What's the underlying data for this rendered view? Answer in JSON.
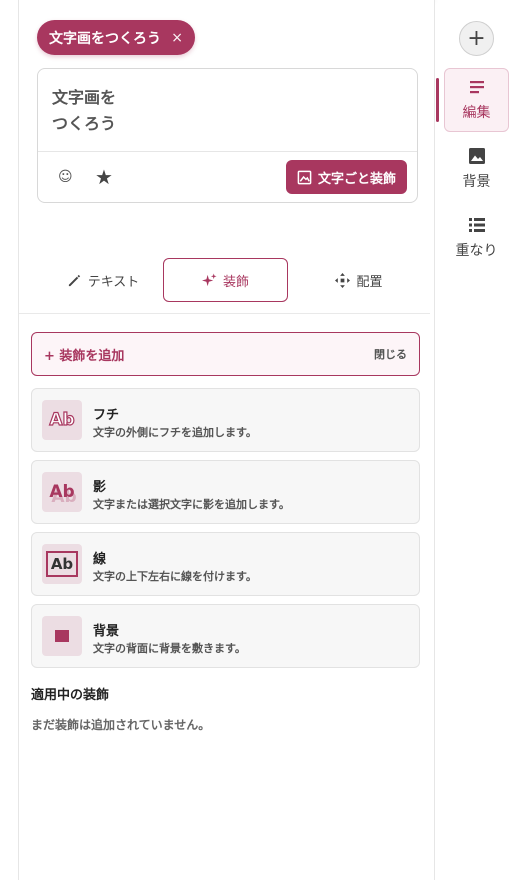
{
  "chip": {
    "label": "文字画をつくろう",
    "close": "×"
  },
  "editor": {
    "line1": "文字画を",
    "line2": "つくろう",
    "emoji_icon": "☺",
    "star_icon": "★",
    "decorate_button": "文字ごと装飾"
  },
  "tabs": [
    {
      "label": "テキスト",
      "icon": "pencil-icon"
    },
    {
      "label": "装飾",
      "icon": "sparkle-icon"
    },
    {
      "label": "配置",
      "icon": "move-arrows-icon"
    }
  ],
  "add_panel": {
    "title": "+ 装飾を追加",
    "close": "閉じる"
  },
  "decorations": [
    {
      "name": "フチ",
      "desc": "文字の外側にフチを追加します。",
      "thumb": "Ab"
    },
    {
      "name": "影",
      "desc": "文字または選択文字に影を追加します。",
      "thumb": "Ab"
    },
    {
      "name": "線",
      "desc": "文字の上下左右に線を付けます。",
      "thumb": "Ab"
    },
    {
      "name": "背景",
      "desc": "文字の背面に背景を敷きます。",
      "thumb": ""
    }
  ],
  "applied": {
    "title": "適用中の装飾",
    "empty": "まだ装飾は追加されていません。"
  },
  "rail": {
    "add": "+",
    "items": [
      {
        "label": "編集",
        "icon": "edit-lines-icon"
      },
      {
        "label": "背景",
        "icon": "image-icon"
      },
      {
        "label": "重なり",
        "icon": "list-icon"
      }
    ]
  },
  "colors": {
    "accent": "#a8375f",
    "accent_light": "#fbf0f4",
    "card_bg": "#f7f7f7"
  }
}
